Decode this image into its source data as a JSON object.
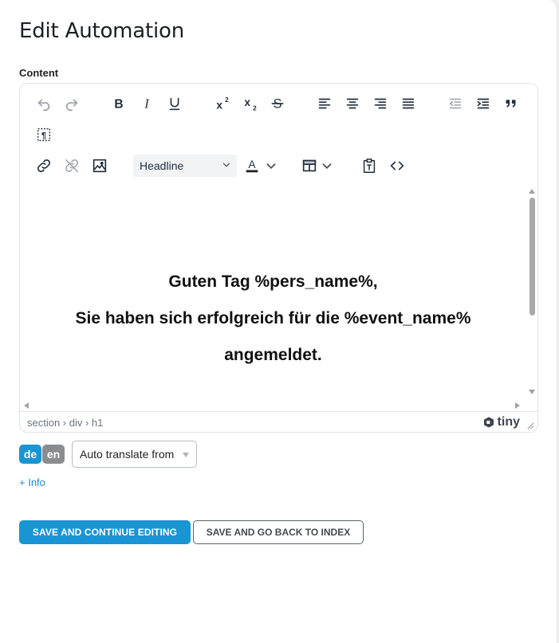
{
  "page": {
    "title": "Edit Automation"
  },
  "content_field": {
    "label": "Content"
  },
  "editor": {
    "toolbar": {
      "format_select": "Headline"
    },
    "content": {
      "lines": [
        "Guten Tag %pers_name%,",
        "Sie haben sich erfolgreich für die %event_name%",
        "angemeldet."
      ]
    },
    "statusbar": {
      "path": "section › div › h1",
      "brand": "tiny"
    }
  },
  "language": {
    "options": [
      "de",
      "en"
    ],
    "selected": "de",
    "translate_select": "Auto translate from"
  },
  "info_link": "+ Info",
  "actions": {
    "save_continue": "SAVE AND CONTINUE EDITING",
    "save_back": "SAVE AND GO BACK TO INDEX"
  },
  "colors": {
    "primary": "#1a95d3",
    "secondary_lang": "#8a8d90",
    "icon": "#222f3e"
  }
}
